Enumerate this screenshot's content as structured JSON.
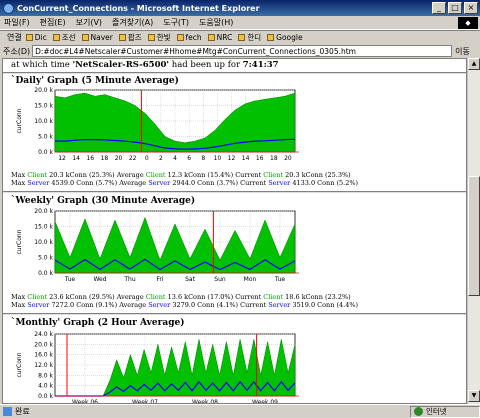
{
  "window": {
    "title": "ConCurrent_Connections - Microsoft Internet Explorer",
    "min": "_",
    "max": "□",
    "close": "×"
  },
  "menu": [
    "파일(F)",
    "편집(E)",
    "보기(V)",
    "즐겨찾기(A)",
    "도구(T)",
    "도움말(H)"
  ],
  "links_bar": {
    "label": "연결",
    "items": [
      "Dic",
      "조선",
      "Naver",
      "팝즈",
      "한빛",
      "fech",
      "NRC",
      "한디",
      "Google"
    ]
  },
  "address": {
    "label": "주소(D)",
    "value": "D:#doc#L4#Netscaler#Customer#Hhome#Mtg#ConCurrent_Connections_0305.htm",
    "go": "이동"
  },
  "page": {
    "intro_prefix": "at which time",
    "host": "'NetScaler-RS-6500'",
    "intro_mid": "had been up for",
    "uptime": "7:41:37",
    "daily": {
      "title": "`Daily' Graph (5 Minute Average)",
      "stats": {
        "r1_a": "Max",
        "r1_client": "Client",
        "r1_b": "20.3 kConn (25.3%)  Average",
        "r1_client2": "Client",
        "r1_c": "12.3 kConn (15.4%)  Current",
        "r1_client3": "Client",
        "r1_d": "20.3 kConn (25.3%)",
        "r2_a": "Max",
        "r2_server": "Server",
        "r2_b": "4539.0 Conn (5.7%)  Average",
        "r2_server2": "Server",
        "r2_c": "2944.0 Conn (3.7%)  Current",
        "r2_server3": "Server",
        "r2_d": "4133.0 Conn (5.2%)"
      }
    },
    "weekly": {
      "title": "`Weekly' Graph (30 Minute Average)",
      "stats": {
        "r1_a": "Max",
        "r1_client": "Client",
        "r1_b": "23.6 kConn (29.5%)  Average",
        "r1_client2": "Client",
        "r1_c": "13.6 kConn (17.0%)  Current",
        "r1_client3": "Client",
        "r1_d": "18.6 kConn (23.2%)",
        "r2_a": "Max",
        "r2_server": "Server",
        "r2_b": "7272.0 Conn (9.1%)  Average",
        "r2_server2": "Server",
        "r2_c": "3279.0 Conn (4.1%)  Current",
        "r2_server3": "Server",
        "r2_d": "3519.0 Conn (4.4%)"
      }
    },
    "monthly": {
      "title": "`Monthly' Graph (2 Hour Average)"
    }
  },
  "chart_data": [
    {
      "type": "area",
      "ylabel": "curConn",
      "yticks": [
        "0.0 k",
        "5.0 k",
        "10.0 k",
        "15.0 k",
        "20.0 k"
      ],
      "ylim": [
        0,
        20000
      ],
      "xticks": [
        "12",
        "14",
        "16",
        "18",
        "20",
        "22",
        "0",
        "2",
        "4",
        "6",
        "8",
        "10",
        "12",
        "14",
        "16",
        "18",
        "20"
      ],
      "series": [
        {
          "values": [
            18000,
            17500,
            18500,
            19000,
            18000,
            18500,
            17500,
            16500,
            15000,
            12500,
            9000,
            5000,
            3500,
            3000,
            3500,
            4500,
            7000,
            10500,
            13500,
            15500,
            16500,
            17000,
            17500,
            18000,
            19000
          ]
        },
        {
          "values": [
            3500,
            3500,
            3800,
            4000,
            4000,
            3900,
            3700,
            3500,
            3200,
            2700,
            2000,
            1300,
            1000,
            900,
            1000,
            1200,
            1600,
            2200,
            2800,
            3200,
            3500,
            3600,
            3800,
            4000,
            4100
          ]
        }
      ],
      "colors": {
        "client": "#00c000",
        "server": "#0000ff",
        "mark": "#ff0000"
      }
    },
    {
      "type": "area",
      "ylabel": "curConn",
      "yticks": [
        "0.0 k",
        "5.0 k",
        "10.0 k",
        "15.0 k",
        "20.0 k"
      ],
      "ylim": [
        0,
        24000
      ],
      "xticks": [
        "Tue",
        "Wed",
        "Thu",
        "Fri",
        "Sat",
        "Sun",
        "Mon",
        "Tue"
      ],
      "series": [
        {
          "values": [
            20000,
            6000,
            21000,
            5500,
            20500,
            6000,
            21500,
            5000,
            19000,
            5500,
            17000,
            5000,
            16500,
            5500,
            20500,
            6000,
            19000
          ]
        },
        {
          "values": [
            5000,
            1500,
            5200,
            1400,
            5100,
            1500,
            5300,
            1300,
            4700,
            1400,
            4200,
            1300,
            4100,
            1400,
            5100,
            1500,
            4700
          ]
        }
      ],
      "colors": {
        "client": "#00c000",
        "server": "#0000ff",
        "mark": "#ff0000"
      }
    },
    {
      "type": "area",
      "ylabel": "curConn",
      "yticks": [
        "0.0 k",
        "4.0 k",
        "8.0 k",
        "12.0 k",
        "16.0 k",
        "20.0 k",
        "24.0 k"
      ],
      "ylim": [
        0,
        24000
      ],
      "xticks": [
        "Week 06",
        "Week 07",
        "Week 08",
        "Week 09"
      ],
      "series": [
        {
          "values": [
            0,
            0,
            0,
            0,
            0,
            0,
            0,
            0,
            6000,
            14000,
            7000,
            16000,
            8000,
            18000,
            9000,
            20000,
            8000,
            19000,
            9000,
            21000,
            8000,
            22000,
            9000,
            20000,
            8000,
            21000,
            8000,
            22000,
            9000,
            22000,
            8000,
            21000,
            8000,
            22000,
            9000,
            20000
          ]
        },
        {
          "values": [
            0,
            0,
            0,
            0,
            0,
            0,
            0,
            0,
            1500,
            3500,
            1800,
            4000,
            2000,
            4500,
            2200,
            5000,
            2000,
            4700,
            2200,
            5200,
            2000,
            5500,
            2200,
            5000,
            2000,
            5200,
            2000,
            5500,
            2200,
            5500,
            2000,
            5200,
            2000,
            5500,
            2200,
            5000
          ]
        }
      ],
      "colors": {
        "client": "#00c000",
        "server": "#0000ff",
        "mark": "#ff0000"
      }
    }
  ],
  "status": {
    "text": "완료",
    "zone": "인터넷"
  }
}
